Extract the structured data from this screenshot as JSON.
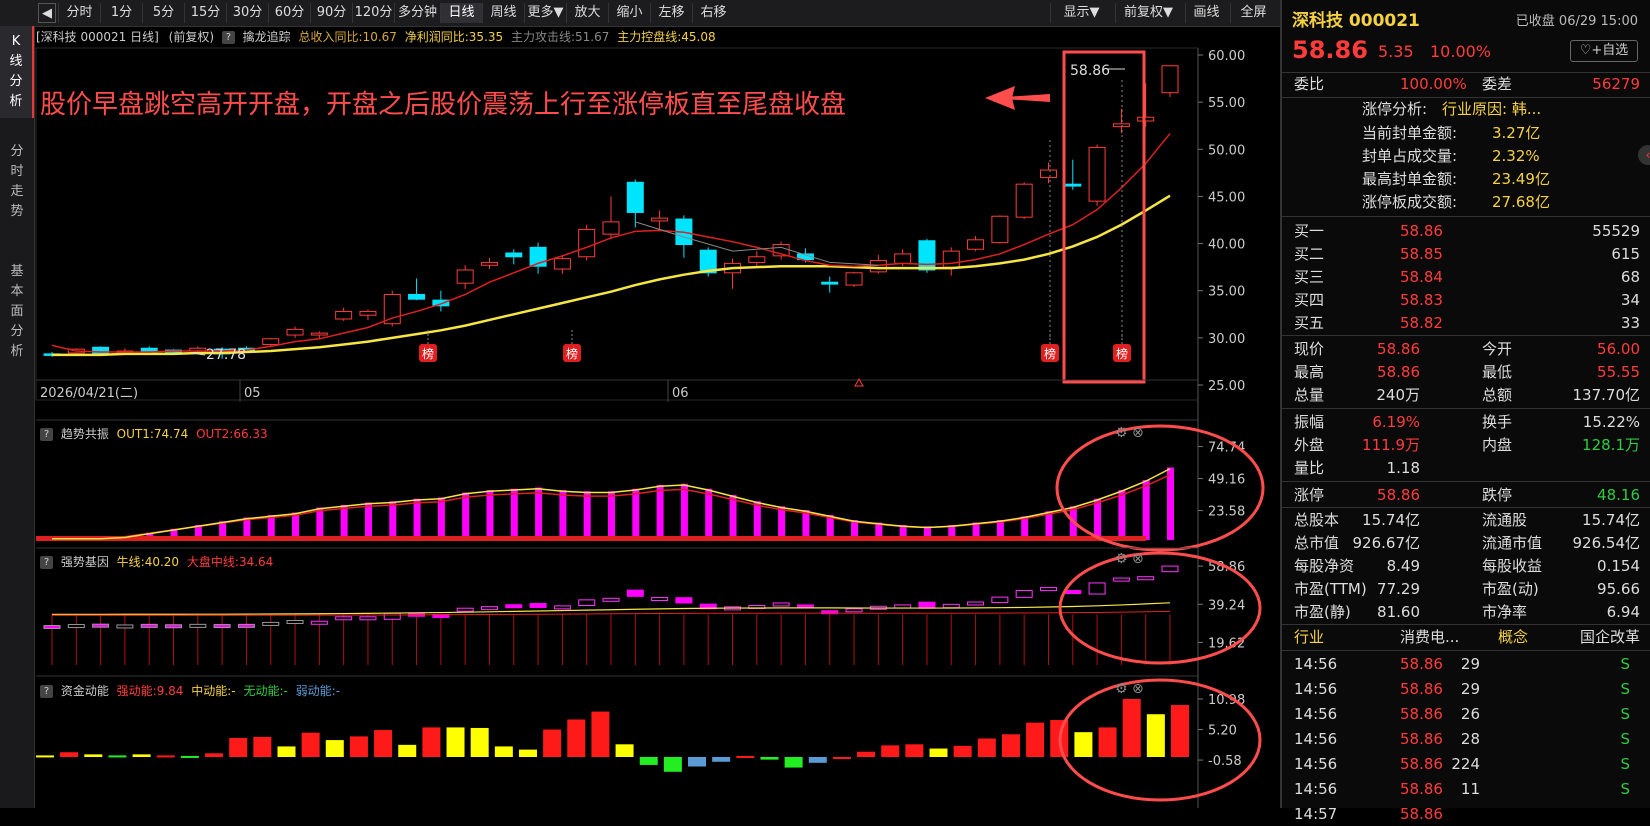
{
  "toolbar": {
    "buttons": [
      "分时",
      "1分",
      "5分",
      "15分",
      "30分",
      "60分",
      "90分",
      "120分",
      "多分钟",
      "日线",
      "周线",
      "更多▼",
      "放大",
      "缩小",
      "左移",
      "右移"
    ],
    "right_buttons": [
      "显示▼",
      "前复权▼",
      "画线",
      "全屏"
    ],
    "active": "日线"
  },
  "sidebar": {
    "tabs": [
      "K线分析",
      "分时走势",
      "基本面分析"
    ]
  },
  "kchart": {
    "title": "[深科技 000021 日线]",
    "adjust": "(前复权)",
    "indicator_name": "擒龙追踪",
    "revenue": "总收入同比:10.67",
    "profit": "净利润同比:35.35",
    "attack": "主力攻击线:51.67",
    "control": "主力控盘线:45.08",
    "annotation": "股价早盘跳空高开开盘，开盘之后股价震荡上行至涨停板直至尾盘收盘",
    "date_label": "2026/04/21(二)",
    "month_labels": [
      "05",
      "06"
    ],
    "y_ticks": [
      "60.00",
      "55.00",
      "50.00",
      "45.00",
      "40.00",
      "35.00",
      "30.00",
      "25.00"
    ],
    "low_label": "27.78",
    "high_label": "58.86",
    "bang": "榜"
  },
  "p1": {
    "name": "趋势共振",
    "out1": "OUT1:74.74",
    "out2": "OUT2:66.33",
    "ticks": [
      "74.74",
      "49.16",
      "23.58"
    ]
  },
  "p2": {
    "name": "强势基因",
    "bull": "牛线:40.20",
    "mid": "大盘中线:34.64",
    "ticks": [
      "58.86",
      "39.24",
      "19.62"
    ]
  },
  "p3": {
    "name": "资金动能",
    "strong": "强动能:9.84",
    "medium": "中动能:-",
    "none": "无动能:-",
    "weak": "弱动能:-",
    "ticks": [
      "10.98",
      "5.20",
      "-0.58"
    ]
  },
  "chart_data": [
    {
      "type": "candlestick",
      "title": "深科技 000021 日线",
      "ylim": [
        25,
        60
      ],
      "candles": [
        [
          28.3,
          28.5,
          28.0,
          28.2
        ],
        [
          28.4,
          28.9,
          28.2,
          28.8
        ],
        [
          29.0,
          29.1,
          28.1,
          28.2
        ],
        [
          28.4,
          28.9,
          28.3,
          28.6
        ],
        [
          28.9,
          29.1,
          28.5,
          28.6
        ],
        [
          28.7,
          28.8,
          28.4,
          28.5
        ],
        [
          28.6,
          29.1,
          28.5,
          28.9
        ],
        [
          28.8,
          29.0,
          27.78,
          28.3
        ],
        [
          28.9,
          29.1,
          28.4,
          28.6
        ],
        [
          29.3,
          30.0,
          29.1,
          29.9
        ],
        [
          30.3,
          31.2,
          30.0,
          30.9
        ],
        [
          30.3,
          30.7,
          29.9,
          30.5
        ],
        [
          32.0,
          33.2,
          31.8,
          32.8
        ],
        [
          32.4,
          33.0,
          31.9,
          32.8
        ],
        [
          31.5,
          35.0,
          31.2,
          34.6
        ],
        [
          34.6,
          36.3,
          34.0,
          34.1
        ],
        [
          34.0,
          35.0,
          32.8,
          33.4
        ],
        [
          35.8,
          37.7,
          35.2,
          37.2
        ],
        [
          37.7,
          38.5,
          37.3,
          38.0
        ],
        [
          39.0,
          39.4,
          37.8,
          38.6
        ],
        [
          39.6,
          40.1,
          36.8,
          37.6
        ],
        [
          37.3,
          38.7,
          36.8,
          38.4
        ],
        [
          38.6,
          42.0,
          38.2,
          41.5
        ],
        [
          41.0,
          45.0,
          40.5,
          42.3
        ],
        [
          46.5,
          46.8,
          41.7,
          43.3
        ],
        [
          42.4,
          43.5,
          41.3,
          42.7
        ],
        [
          42.6,
          43.0,
          38.5,
          39.9
        ],
        [
          39.3,
          39.6,
          36.5,
          36.9
        ],
        [
          36.9,
          38.4,
          35.2,
          37.9
        ],
        [
          38.0,
          39.2,
          37.6,
          38.6
        ],
        [
          38.7,
          40.2,
          38.3,
          39.9
        ],
        [
          38.9,
          39.5,
          38.0,
          38.3
        ],
        [
          35.9,
          36.5,
          34.8,
          35.7
        ],
        [
          35.6,
          37.0,
          35.4,
          36.9
        ],
        [
          37.0,
          38.8,
          36.8,
          38.2
        ],
        [
          37.9,
          39.4,
          37.6,
          38.9
        ],
        [
          40.3,
          40.5,
          36.9,
          37.2
        ],
        [
          37.5,
          39.6,
          36.6,
          39.2
        ],
        [
          39.4,
          40.8,
          39.2,
          40.4
        ],
        [
          40.1,
          43.0,
          40.0,
          42.9
        ],
        [
          42.8,
          46.5,
          42.6,
          46.3
        ],
        [
          47.0,
          48.6,
          46.4,
          47.8
        ],
        [
          46.3,
          48.9,
          45.7,
          46.1
        ],
        [
          44.5,
          50.5,
          44.0,
          50.2
        ],
        [
          52.4,
          54.3,
          51.7,
          52.7
        ],
        [
          53.0,
          57.0,
          52.4,
          53.4
        ],
        [
          56.0,
          58.86,
          55.55,
          58.86
        ]
      ],
      "ma_red": [
        29.2,
        28.6,
        28.5,
        28.5,
        28.5,
        28.6,
        28.6,
        28.6,
        28.7,
        29.1,
        29.6,
        29.9,
        30.5,
        31.1,
        32.1,
        32.8,
        33.6,
        34.6,
        35.9,
        36.9,
        37.9,
        38.7,
        39.6,
        40.6,
        41.3,
        41.4,
        41.2,
        40.7,
        40.2,
        39.6,
        38.9,
        38.2,
        37.7,
        37.6,
        37.7,
        37.9,
        37.8,
        37.9,
        38.3,
        38.9,
        39.9,
        41.0,
        42.0,
        43.6,
        45.9,
        48.5,
        51.67
      ],
      "ma_gray": [],
      "ma_yellow": [
        28.2,
        28.2,
        28.2,
        28.3,
        28.3,
        28.3,
        28.4,
        28.4,
        28.5,
        28.6,
        28.8,
        29.0,
        29.3,
        29.6,
        30.0,
        30.4,
        30.8,
        31.3,
        31.9,
        32.5,
        33.1,
        33.7,
        34.3,
        34.9,
        35.6,
        36.2,
        36.7,
        37.1,
        37.4,
        37.5,
        37.6,
        37.6,
        37.6,
        37.5,
        37.4,
        37.4,
        37.4,
        37.4,
        37.6,
        37.9,
        38.3,
        38.9,
        39.7,
        40.7,
        42.0,
        43.5,
        45.08
      ]
    },
    {
      "type": "bar",
      "title": "趋势共振",
      "ylim": [
        0,
        80
      ],
      "values": [
        5,
        6,
        7,
        8,
        9,
        10,
        11,
        12,
        13,
        15,
        18,
        20,
        24,
        25,
        26,
        28,
        27,
        30,
        33,
        36,
        38,
        41,
        40,
        42,
        45,
        44,
        43,
        40,
        35,
        30,
        27,
        25,
        24,
        22,
        20,
        18,
        17,
        15,
        14,
        13,
        12,
        11,
        10,
        9,
        8,
        7,
        6
      ],
      "bars": [
        1,
        1,
        1,
        1,
        1,
        1,
        1,
        1,
        1,
        12,
        16,
        18,
        22,
        23,
        26,
        30,
        29,
        34,
        38,
        41,
        43,
        44,
        42,
        43,
        48,
        52,
        56,
        55,
        50,
        43,
        38,
        33,
        29,
        27,
        24,
        23,
        20,
        14,
        13,
        14,
        15,
        17,
        18,
        21,
        24,
        28,
        33,
        36,
        40,
        44,
        49,
        55,
        62,
        68,
        74.74
      ],
      "out1": [],
      "out2": []
    },
    {
      "type": "bar",
      "title": "资金动能",
      "ylim": [
        -2,
        11
      ],
      "values": [
        0.3,
        0.9,
        0.5,
        0.3,
        0.5,
        0.3,
        0.2,
        0.7,
        3.6,
        3.8,
        2.0,
        4.6,
        3.2,
        3.9,
        5.1,
        2.3,
        5.6,
        5.6,
        5.5,
        2.0,
        1.4,
        5.2,
        7.1,
        8.6,
        2.4,
        -1.5,
        -2.8,
        -1.8,
        -0.9,
        0.2,
        -0.5,
        -2.0,
        -1.1,
        -0.3,
        1.0,
        2.2,
        2.4,
        1.6,
        2.1,
        3.5,
        4.3,
        6.5,
        7.0,
        4.7,
        5.6,
        10.98,
        8.1,
        9.84
      ]
    }
  ],
  "right": {
    "name": "深科技 000021",
    "status": "已收盘 06/29 15:00",
    "price": "58.86",
    "change": "5.35",
    "pct": "10.00%",
    "fav": "+自选",
    "weibi_label": "委比",
    "weibi": "100.00%",
    "weicha_label": "委差",
    "weicha": "56279",
    "zt_analysis": "涨停分析:",
    "zt_reason": "行业原因: 韩...",
    "zt_rows": [
      [
        "当前封单金额:",
        "3.27亿"
      ],
      [
        "封单占成交量:",
        "2.32%"
      ],
      [
        "最高封单金额:",
        "23.49亿"
      ],
      [
        "涨停板成交额:",
        "27.68亿"
      ]
    ],
    "buy": [
      [
        "买一",
        "58.86",
        "55529"
      ],
      [
        "买二",
        "58.85",
        "615"
      ],
      [
        "买三",
        "58.84",
        "68"
      ],
      [
        "买四",
        "58.83",
        "34"
      ],
      [
        "买五",
        "58.82",
        "33"
      ]
    ],
    "q1": [
      [
        "现价",
        "58.86",
        "今开",
        "56.00"
      ],
      [
        "最高",
        "58.86",
        "最低",
        "55.55"
      ],
      [
        "总量",
        "240万",
        "总额",
        "137.70亿"
      ]
    ],
    "q2": [
      [
        "振幅",
        "6.19%",
        "换手",
        "15.22%"
      ],
      [
        "外盘",
        "111.9万",
        "内盘",
        "128.1万"
      ],
      [
        "量比",
        "1.18",
        "",
        ""
      ]
    ],
    "q3": [
      [
        "涨停",
        "58.86",
        "跌停",
        "48.16"
      ]
    ],
    "f": [
      [
        "总股本",
        "15.74亿",
        "流通股",
        "15.74亿"
      ],
      [
        "总市值",
        "926.67亿",
        "流通市值",
        "926.54亿"
      ],
      [
        "每股净资",
        "8.49",
        "每股收益",
        "0.154"
      ],
      [
        "市盈(TTM)",
        "77.29",
        "市盈(动)",
        "95.66"
      ],
      [
        "市盈(静)",
        "81.60",
        "市净率",
        "6.94"
      ]
    ],
    "ind": [
      "行业",
      "消费电...",
      "概念",
      "国企改革"
    ],
    "ticks": [
      [
        "14:56",
        "58.86",
        "29",
        "S"
      ],
      [
        "14:56",
        "58.86",
        "29",
        "S"
      ],
      [
        "14:56",
        "58.86",
        "26",
        "S"
      ],
      [
        "14:56",
        "58.86",
        "28",
        "S"
      ],
      [
        "14:56",
        "58.86",
        "224",
        "S"
      ],
      [
        "14:56",
        "58.86",
        "11",
        "S"
      ],
      [
        "14:57",
        "58.86",
        "",
        ""
      ]
    ]
  }
}
